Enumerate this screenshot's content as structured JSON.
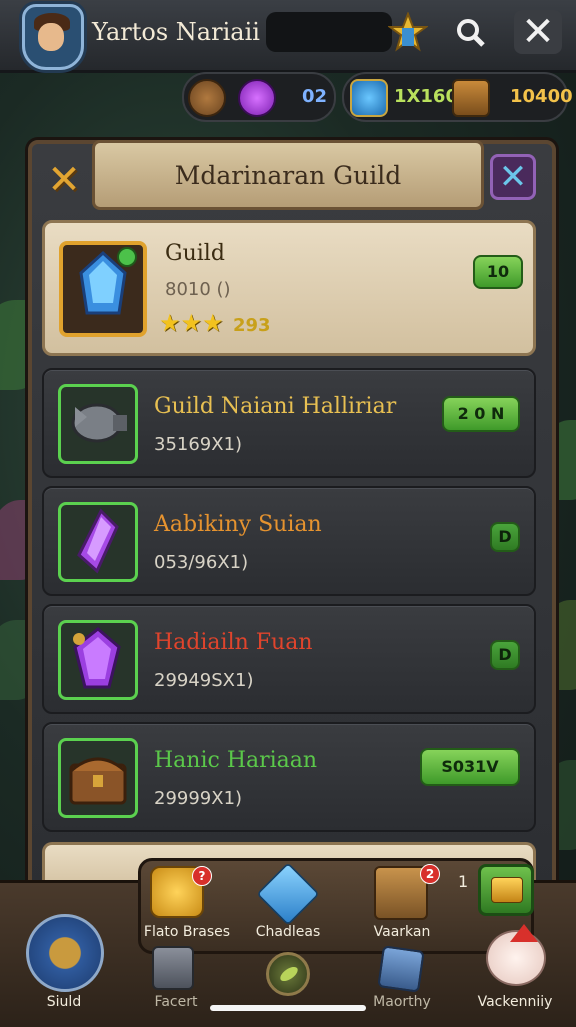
{
  "header": {
    "player_name": "Yartos Nariaii",
    "icons": [
      "avatar-portrait",
      "star-rank-icon",
      "search-icon",
      "close-icon"
    ]
  },
  "resources": {
    "group1_value": "02",
    "group2_value1": "1X160",
    "group2_value2": "10400"
  },
  "panel": {
    "title": "Mdarinaran Guild"
  },
  "guild_card": {
    "name": "Guild",
    "id_text": "8010 ()",
    "stars_text": "293",
    "button": "10"
  },
  "items": [
    {
      "title": "Guild Naiani Halliriar",
      "sub": "35169X1)",
      "button": "2 0 N",
      "title_color": "#e8c052"
    },
    {
      "title": "Aabikiny Suian",
      "sub": "053/96X1)",
      "button": "D",
      "title_color": "#e6932f"
    },
    {
      "title": "Hadiailn Fuan",
      "sub": "29949SX1)",
      "button": "D",
      "title_color": "#e0442c"
    },
    {
      "title": "Hanic Hariaan",
      "sub": "29999X1)",
      "button": "S031V",
      "title_color": "#5bc84a"
    }
  ],
  "bottom_nav": {
    "top_row": [
      {
        "label": "Flato Brases",
        "badge": "?"
      },
      {
        "label": "Chadleas",
        "badge": ""
      },
      {
        "label": "Vaarkan",
        "badge": "2"
      }
    ],
    "partial_value": "1",
    "bottom_row": [
      {
        "label": "Siuld"
      },
      {
        "label": "Facert"
      },
      {
        "label": "Maorthy"
      },
      {
        "label": "Vackenniiy"
      }
    ]
  },
  "colors": {
    "accent_green": "#5bd14f",
    "accent_gold": "#e0a22d",
    "panel_border": "#5b4631"
  }
}
